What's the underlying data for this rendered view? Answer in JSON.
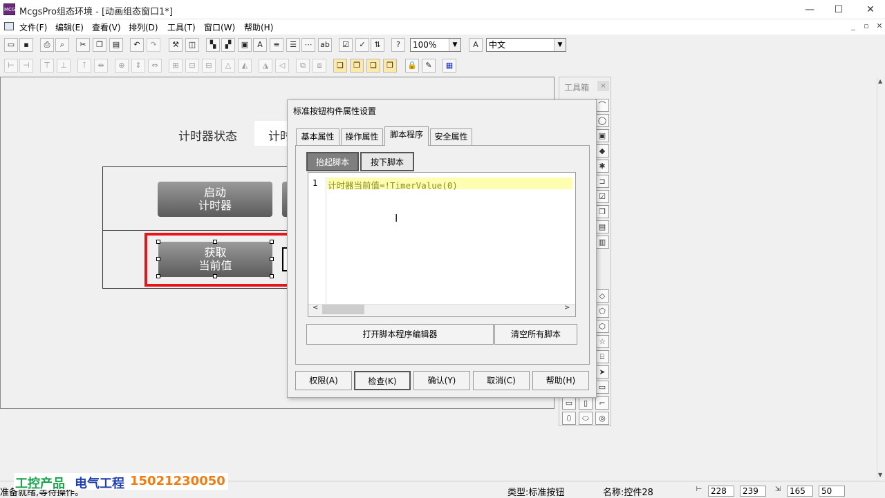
{
  "window": {
    "title": "McgsPro组态环境 - [动画组态窗口1*]",
    "app_icon_label": "MCGS",
    "controls": {
      "minimize": "—",
      "maximize": "☐",
      "close": "✕"
    },
    "mdi_controls": {
      "minimize": "_",
      "restore": "▫",
      "close": "✕"
    }
  },
  "menu": [
    "文件(F)",
    "编辑(E)",
    "查看(V)",
    "排列(D)",
    "工具(T)",
    "窗口(W)",
    "帮助(H)"
  ],
  "toolbar": {
    "zoom": "100%",
    "language": "中文"
  },
  "canvas": {
    "timer_label": "计时器状态",
    "timer_value_partial": "计时",
    "start_button": [
      "启动",
      "计时器"
    ],
    "get_button": [
      "获取",
      "当前值"
    ]
  },
  "toolbox": {
    "title": "工具箱",
    "close": "×"
  },
  "dialog": {
    "title": "标准按钮构件属性设置",
    "tabs": [
      "基本属性",
      "操作属性",
      "脚本程序",
      "安全属性"
    ],
    "active_tab": "脚本程序",
    "subtabs": {
      "release": "抬起脚本",
      "press": "按下脚本"
    },
    "editor": {
      "line_number": "1",
      "code": "计时器当前值=!TimerValue(0)"
    },
    "open_editor_button": "打开脚本程序编辑器",
    "clear_button": "清空所有脚本",
    "buttons": {
      "permission": "权限(A)",
      "check": "检查(K)",
      "confirm": "确认(Y)",
      "cancel": "取消(C)",
      "help": "帮助(H)"
    }
  },
  "status": {
    "text": "准备就绪,等待操作。",
    "type": "类型:标准按钮",
    "name": "名称:控件28",
    "x": "228",
    "y": "239",
    "width": "165",
    "height": "50"
  },
  "watermark": {
    "part1": "工控产品",
    "part2": "电气工程",
    "part3": "15021230050"
  },
  "colors": {
    "selection": "#e8141c",
    "code_text": "#8c8c1c",
    "code_highlight": "#fefeb0",
    "watermark_green": "#16a34a",
    "watermark_blue": "#1e3fae",
    "watermark_orange": "#f07c12"
  }
}
